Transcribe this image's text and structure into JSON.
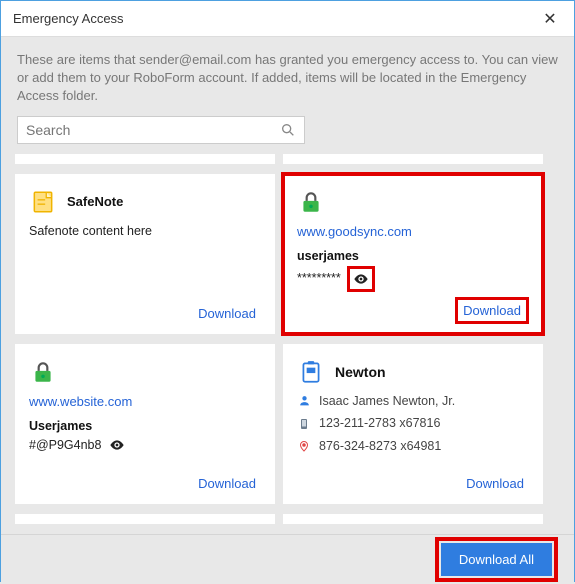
{
  "window": {
    "title": "Emergency Access"
  },
  "desc": {
    "pre": "These are items that ",
    "email": "sender@email.com",
    "post": " has granted you emergency access to. You can view or add them to your RoboForm account. If added, items will be located in the Emergency Access folder."
  },
  "search": {
    "placeholder": "Search"
  },
  "labels": {
    "download": "Download",
    "download_all": "Download All"
  },
  "cards": {
    "safenote": {
      "title": "SafeNote",
      "content": "Safenote content here"
    },
    "goodsync": {
      "url": "www.goodsync.com",
      "user": "userjames",
      "password_mask": "*********"
    },
    "website": {
      "url": "www.website.com",
      "user": "Userjames",
      "password": "#@P9G4nb8"
    },
    "newton": {
      "title": "Newton",
      "name": "Isaac James Newton, Jr.",
      "phone1": "123-211-2783 x67816",
      "phone2": "876-324-8273 x64981"
    }
  }
}
